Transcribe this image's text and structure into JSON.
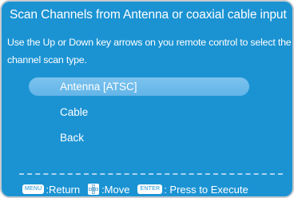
{
  "title": "Scan  Channels from Antenna or coaxial cable input",
  "instruction": "Use the Up or Down key arrows on you remote control to select the channel scan type.",
  "options": [
    {
      "label": "Antenna [ATSC]",
      "selected": true
    },
    {
      "label": "Cable",
      "selected": false
    },
    {
      "label": "Back",
      "selected": false
    }
  ],
  "footer": {
    "menu_key": "MENU",
    "menu_label": ":Return",
    "move_icon": "dpad-icon",
    "move_label": ":Move",
    "enter_key": "ENTER",
    "enter_label": ": Press to Execute"
  },
  "colors": {
    "background": "#1b93d3",
    "highlight": "#6ab9ea",
    "text": "#ffffff"
  }
}
